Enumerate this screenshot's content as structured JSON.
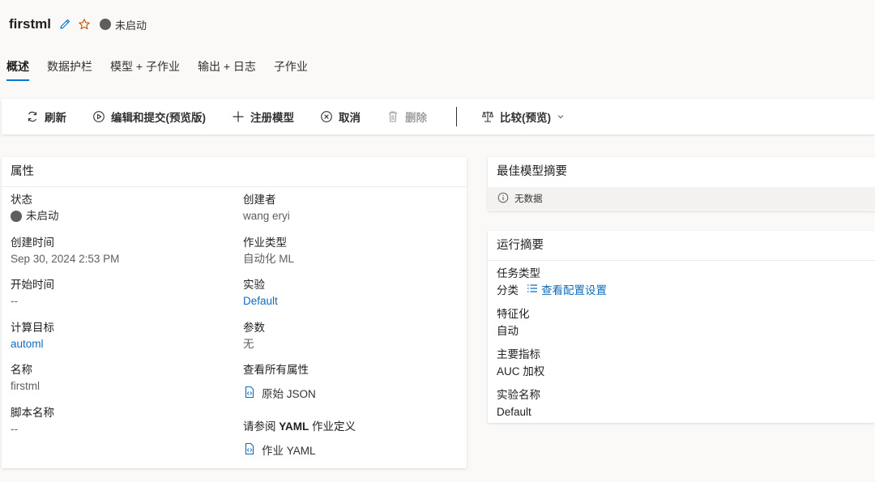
{
  "header": {
    "title": "firstml",
    "status": "未启动",
    "edit_icon": "pencil-icon",
    "favorite_icon": "star-icon"
  },
  "tabs": [
    {
      "label": "概述",
      "active": true
    },
    {
      "label": "数据护栏",
      "active": false
    },
    {
      "label": "模型 + 子作业",
      "active": false
    },
    {
      "label": "输出 + 日志",
      "active": false
    },
    {
      "label": "子作业",
      "active": false
    }
  ],
  "toolbar": {
    "refresh": "刷新",
    "edit_submit": "编辑和提交(预览版)",
    "register_model": "注册模型",
    "cancel": "取消",
    "delete": "删除",
    "compare": "比较(预览)"
  },
  "properties": {
    "title": "属性",
    "status_label": "状态",
    "status_value": "未启动",
    "created_label": "创建时间",
    "created_value": "Sep 30, 2024 2:53 PM",
    "start_label": "开始时间",
    "start_value": "--",
    "compute_label": "计算目标",
    "compute_value": "automl",
    "name_label": "名称",
    "name_value": "firstml",
    "script_label": "脚本名称",
    "script_value": "--",
    "creator_label": "创建者",
    "creator_value": "wang eryi",
    "jobtype_label": "作业类型",
    "jobtype_value": "自动化 ML",
    "experiment_label": "实验",
    "experiment_value": "Default",
    "params_label": "参数",
    "params_value": "无",
    "all_props_label": "查看所有属性",
    "raw_json": "原始 JSON",
    "yaml_prefix": "请参阅 ",
    "yaml_bold": "YAML",
    "yaml_suffix": " 作业定义",
    "job_yaml": "作业 YAML"
  },
  "best_model": {
    "title": "最佳模型摘要",
    "no_data": "无数据"
  },
  "run_summary": {
    "title": "运行摘要",
    "task_label": "任务类型",
    "task_value": "分类",
    "config_link": "查看配置设置",
    "featurization_label": "特征化",
    "featurization_value": "自动",
    "metric_label": "主要指标",
    "metric_value": "AUC 加权",
    "experiment_label": "实验名称",
    "experiment_value": "Default"
  },
  "colors": {
    "accent": "#0078d4",
    "link": "#0f6cbd",
    "status_grey": "#605e5c"
  }
}
